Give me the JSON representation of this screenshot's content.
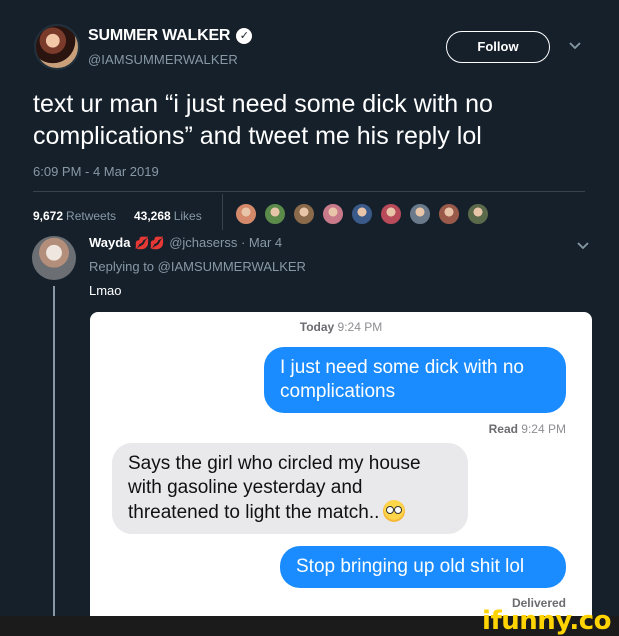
{
  "tweet": {
    "display_name": "SUMMER WALKER",
    "verified_mark": "✓",
    "handle": "@IAMSUMMERWALKER",
    "follow_label": "Follow",
    "text_line1": "text ur man “i just need some dick with no",
    "text_line2": "complications” and tweet me his reply lol",
    "timestamp": "6:09 PM - 4 Mar 2019",
    "retweets_count": "9,672",
    "retweets_label": "Retweets",
    "likes_count": "43,268",
    "likes_label": "Likes",
    "liker_avatar_colors": [
      "#d48a6a",
      "#5b8a4a",
      "#8a6a4a",
      "#c97a8a",
      "#3a5a8a",
      "#b84a5a",
      "#6a7a8a",
      "#9a5a4a",
      "#5a6a4a"
    ]
  },
  "reply": {
    "display_name": "Wayda",
    "emoji": "💋💋",
    "handle": "@jchaserss",
    "date": "Mar 4",
    "replying_to": "Replying to @IAMSUMMERWALKER",
    "text": "Lmao"
  },
  "imessage": {
    "today_label": "Today",
    "today_time": "9:24 PM",
    "msg1_line1": "I just need some dick with no",
    "msg1_line2": "complications",
    "read_label": "Read",
    "read_time": "9:24 PM",
    "msg2_line1": "Says the girl who circled my house",
    "msg2_line2": "with gasoline yesterday and",
    "msg2_line3": "threatened to light the match..",
    "msg3": "Stop bringing up old shit lol",
    "delivered_label": "Delivered",
    "colors": {
      "sent": "#1a8cff",
      "received": "#e9e9eb"
    }
  },
  "watermark": {
    "text": "ifunny.co"
  }
}
